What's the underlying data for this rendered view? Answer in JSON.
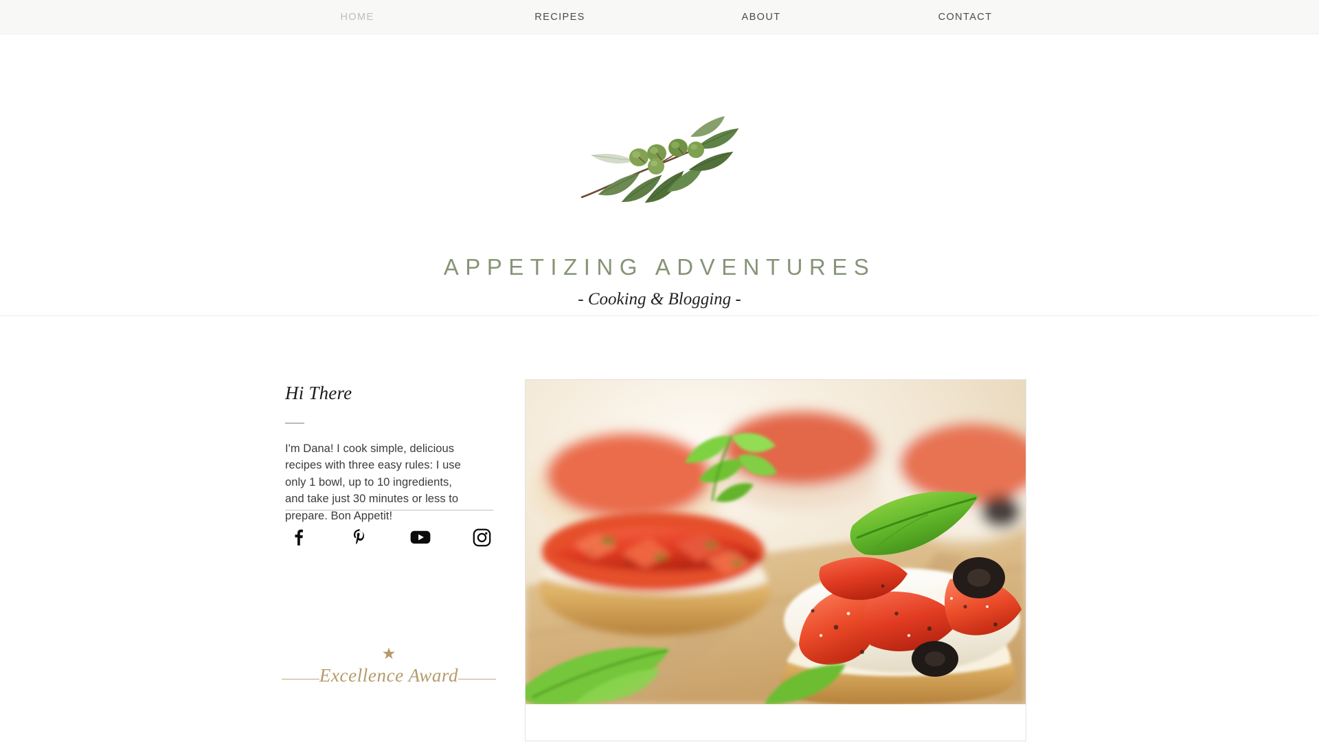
{
  "nav": {
    "items": [
      {
        "label": "HOME",
        "active": true,
        "name": "nav-item-home"
      },
      {
        "label": "RECIPES",
        "active": false,
        "name": "nav-item-recipes"
      },
      {
        "label": "ABOUT",
        "active": false,
        "name": "nav-item-about"
      },
      {
        "label": "CONTACT",
        "active": false,
        "name": "nav-item-contact"
      }
    ]
  },
  "header": {
    "logo_icon": "olive-branch-illustration",
    "title": "APPETIZING ADVENTURES",
    "tagline": "- Cooking & Blogging -"
  },
  "intro": {
    "heading": "Hi There",
    "body": "I'm Dana! I cook simple, delicious recipes with three easy rules: I use only 1 bowl, up to 10 ingredients, and take just 30 minutes or less to prepare. Bon Appetit!"
  },
  "social": [
    {
      "label": "Facebook",
      "icon": "facebook-icon"
    },
    {
      "label": "Pinterest",
      "icon": "pinterest-icon"
    },
    {
      "label": "YouTube",
      "icon": "youtube-icon"
    },
    {
      "label": "Instagram",
      "icon": "instagram-icon"
    }
  ],
  "award": {
    "star_glyph": "★",
    "text": "Excellence Award"
  },
  "photo": {
    "alt": "Bruschetta with tomatoes, mozzarella, olives and basil on a wooden board"
  },
  "colors": {
    "nav_bg": "#f8f8f6",
    "nav_text": "#4a4a4a",
    "nav_active": "#bdbdb8",
    "title_green": "#879477",
    "award_gold": "#b49a6a",
    "body_text": "#3b3b3b",
    "page_bg": "#ffffff"
  }
}
